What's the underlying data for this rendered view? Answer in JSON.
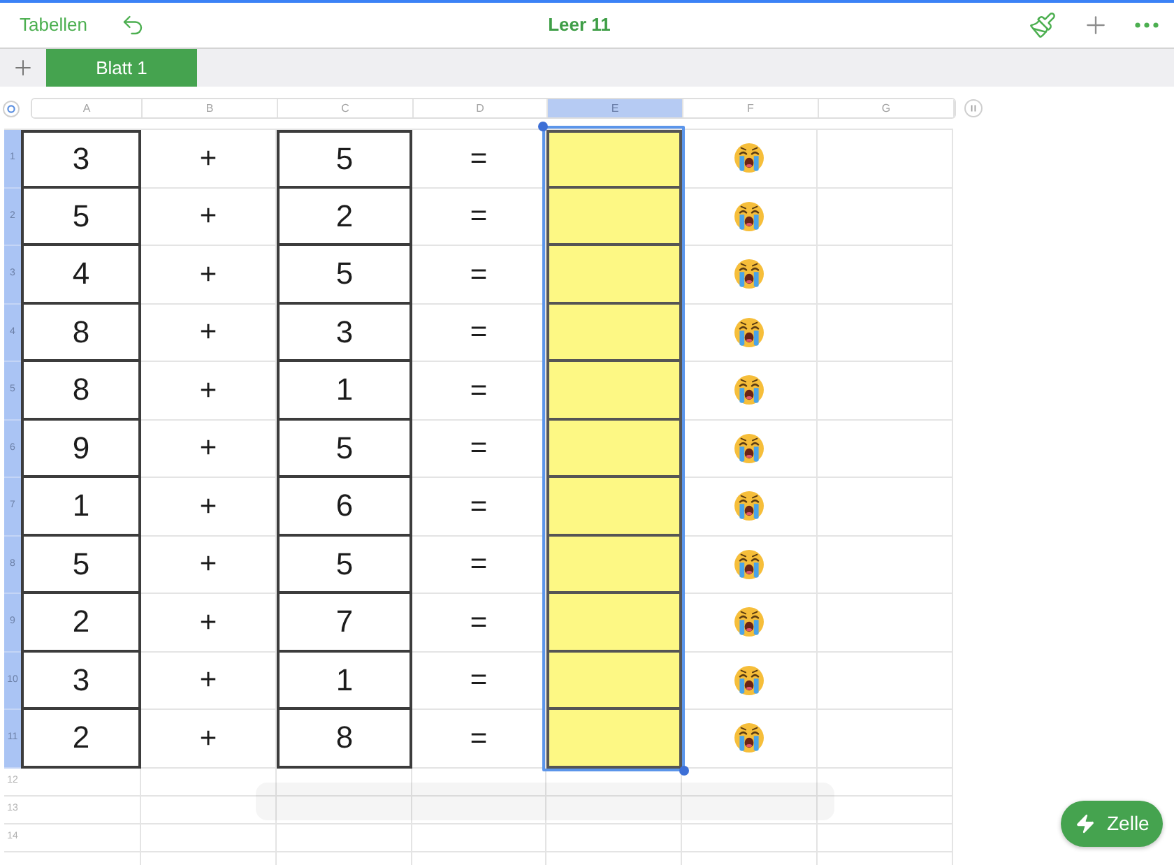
{
  "toolbar": {
    "back_label": "Tabellen",
    "title": "Leer 11"
  },
  "sheet_tabs": [
    {
      "label": "Blatt 1",
      "selected": true
    }
  ],
  "columns": [
    {
      "label": "A",
      "selected": false
    },
    {
      "label": "B",
      "selected": false
    },
    {
      "label": "C",
      "selected": false
    },
    {
      "label": "D",
      "selected": false
    },
    {
      "label": "E",
      "selected": true
    },
    {
      "label": "F",
      "selected": false
    },
    {
      "label": "G",
      "selected": false
    }
  ],
  "rows": [
    {
      "number": "1",
      "selected": true,
      "cells": [
        {
          "text": "3",
          "kind": "number"
        },
        {
          "text": "+",
          "kind": "operator"
        },
        {
          "text": "5",
          "kind": "number"
        },
        {
          "text": "=",
          "kind": "operator"
        }
      ]
    },
    {
      "number": "2",
      "selected": true,
      "cells": [
        {
          "text": "5",
          "kind": "number"
        },
        {
          "text": "+",
          "kind": "operator"
        },
        {
          "text": "2",
          "kind": "number"
        },
        {
          "text": "=",
          "kind": "operator"
        }
      ]
    },
    {
      "number": "3",
      "selected": true,
      "cells": [
        {
          "text": "4",
          "kind": "number"
        },
        {
          "text": "+",
          "kind": "operator"
        },
        {
          "text": "5",
          "kind": "number"
        },
        {
          "text": "=",
          "kind": "operator"
        }
      ]
    },
    {
      "number": "4",
      "selected": true,
      "cells": [
        {
          "text": "8",
          "kind": "number"
        },
        {
          "text": "+",
          "kind": "operator"
        },
        {
          "text": "3",
          "kind": "number"
        },
        {
          "text": "=",
          "kind": "operator"
        }
      ]
    },
    {
      "number": "5",
      "selected": true,
      "cells": [
        {
          "text": "8",
          "kind": "number"
        },
        {
          "text": "+",
          "kind": "operator"
        },
        {
          "text": "1",
          "kind": "number"
        },
        {
          "text": "=",
          "kind": "operator"
        }
      ]
    },
    {
      "number": "6",
      "selected": true,
      "cells": [
        {
          "text": "9",
          "kind": "number"
        },
        {
          "text": "+",
          "kind": "operator"
        },
        {
          "text": "5",
          "kind": "number"
        },
        {
          "text": "=",
          "kind": "operator"
        }
      ]
    },
    {
      "number": "7",
      "selected": true,
      "cells": [
        {
          "text": "1",
          "kind": "number"
        },
        {
          "text": "+",
          "kind": "operator"
        },
        {
          "text": "6",
          "kind": "number"
        },
        {
          "text": "=",
          "kind": "operator"
        }
      ]
    },
    {
      "number": "8",
      "selected": true,
      "cells": [
        {
          "text": "5",
          "kind": "number"
        },
        {
          "text": "+",
          "kind": "operator"
        },
        {
          "text": "5",
          "kind": "number"
        },
        {
          "text": "=",
          "kind": "operator"
        }
      ]
    },
    {
      "number": "9",
      "selected": true,
      "cells": [
        {
          "text": "2",
          "kind": "number"
        },
        {
          "text": "+",
          "kind": "operator"
        },
        {
          "text": "7",
          "kind": "number"
        },
        {
          "text": "=",
          "kind": "operator"
        }
      ]
    },
    {
      "number": "10",
      "selected": true,
      "cells": [
        {
          "text": "3",
          "kind": "number"
        },
        {
          "text": "+",
          "kind": "operator"
        },
        {
          "text": "1",
          "kind": "number"
        },
        {
          "text": "=",
          "kind": "operator"
        }
      ]
    },
    {
      "number": "11",
      "selected": true,
      "cells": [
        {
          "text": "2",
          "kind": "number"
        },
        {
          "text": "+",
          "kind": "operator"
        },
        {
          "text": "8",
          "kind": "number"
        },
        {
          "text": "=",
          "kind": "operator"
        }
      ]
    },
    {
      "number": "12",
      "selected": false
    },
    {
      "number": "13",
      "selected": false
    },
    {
      "number": "14",
      "selected": false
    }
  ],
  "action_button": {
    "label": "Zelle"
  }
}
